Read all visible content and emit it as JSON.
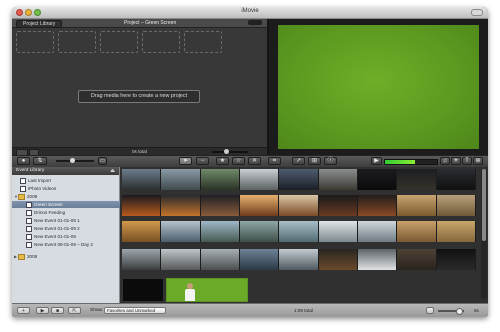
{
  "window": {
    "title": "iMovie"
  },
  "project": {
    "library_button": "Project Library",
    "title": "Project – Green Screen",
    "drag_message": "Drag media here to create a new project",
    "total": "0s total"
  },
  "library": {
    "header": "Event Library",
    "items": [
      {
        "label": "Last Import",
        "kind": "import"
      },
      {
        "label": "iPhoto Videos",
        "kind": "iphoto"
      },
      {
        "label": "2009",
        "kind": "year"
      },
      {
        "label": "Green Screen",
        "kind": "event",
        "selected": true
      },
      {
        "label": "Drinos Feeding",
        "kind": "event"
      },
      {
        "label": "New Event 01-01-09 1",
        "kind": "event"
      },
      {
        "label": "New Event 01-01-09 2",
        "kind": "event"
      },
      {
        "label": "New Event 01-01-09",
        "kind": "event"
      },
      {
        "label": "New Event 09-01-09 – Day 2",
        "kind": "event"
      },
      {
        "label": "2008",
        "kind": "year"
      }
    ]
  },
  "bottom": {
    "show_label": "Show:",
    "show_value": "Favorites and Unmarked",
    "total": "1:09 total",
    "zoom_value": "5s"
  },
  "toolbar": {
    "tools": [
      "arrow-tool",
      "crop-tool",
      "favorite-star",
      "unmark-star",
      "reject-x",
      "keyword-key",
      "voiceover-mic",
      "crop-frame",
      "info"
    ]
  },
  "colors": {
    "green_screen": "#5c9a20",
    "selection": "#6a7e98"
  }
}
